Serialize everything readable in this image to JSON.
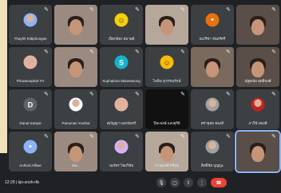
{
  "meeting": {
    "time": "12:29",
    "separator": "|",
    "code": "kjo-snoh-rtb"
  },
  "tiles": [
    {
      "name": "Thayfel Kittiphongse",
      "avatar": "",
      "color": "#8ab4f8",
      "cam": false,
      "photo": true
    },
    {
      "name": "",
      "cam": true
    },
    {
      "name": "เปิดกล้อง สมายด์",
      "avatar": "",
      "color": "#f6d000",
      "cam": false,
      "smiley": true
    },
    {
      "name": "",
      "cam": true
    },
    {
      "name": "ณปรีชา จันทร์ศรี",
      "avatar": "",
      "color": "#e8710a",
      "cam": false,
      "person": true
    },
    {
      "name": "",
      "cam": true
    },
    {
      "name": "Phuwanaphat TH",
      "avatar": "",
      "color": "#e8b0a0",
      "cam": false,
      "photo": true
    },
    {
      "name": "",
      "cam": true
    },
    {
      "name": "Suphakorn Maneewong",
      "avatar": "S",
      "color": "#12b5cb",
      "cam": false
    },
    {
      "name": "ไพลิน สุวรรณรักษ์",
      "avatar": "",
      "color": "#fbbc04",
      "cam": false,
      "smiley": true
    },
    {
      "name": "",
      "cam": true
    },
    {
      "name": "ณัฐดนัย สุทธิพงศ์",
      "avatar": "",
      "color": "#8ab4f8",
      "cam": true
    },
    {
      "name": "Danai Kanpai",
      "avatar": "D",
      "color": "#5f6368",
      "cam": false
    },
    {
      "name": "Panumas Yoothai",
      "avatar": "",
      "color": "#fff",
      "cam": false,
      "photo": true
    },
    {
      "name": "ศุภัญญา แสงจันทร์",
      "avatar": "",
      "color": "#e8b0a0",
      "cam": false,
      "photo": true
    },
    {
      "name": "ปิยะพงษ์ แสงสุรีย์",
      "cam": true,
      "dark": true
    },
    {
      "name": "ศรายุทธ ทองดี",
      "avatar": "",
      "color": "#a0a0a0",
      "cam": false,
      "photo": true
    },
    {
      "name": "ภาวินี ทองดี",
      "avatar": "",
      "color": "#c5221f",
      "cam": false,
      "photo": true
    },
    {
      "name": "Anthod Affiwe",
      "avatar": "",
      "color": "#8ab4f8",
      "cam": false,
      "person": true
    },
    {
      "name": "Siw...",
      "cam": true
    },
    {
      "name": "ณภัทร ไชยวิชัย",
      "avatar": "",
      "color": "#d7aefb",
      "cam": false,
      "photo": true
    },
    {
      "name": "ภาณุพงศ์ ศรีสุข",
      "cam": true
    },
    {
      "name": "สิทธิ์ชัย บุญญะ",
      "avatar": "",
      "color": "#a0a0a0",
      "cam": false,
      "photo": true
    },
    {
      "name": "",
      "cam": true,
      "active": true
    }
  ],
  "controls": [
    "mic",
    "cam",
    "present",
    "more",
    "end"
  ]
}
